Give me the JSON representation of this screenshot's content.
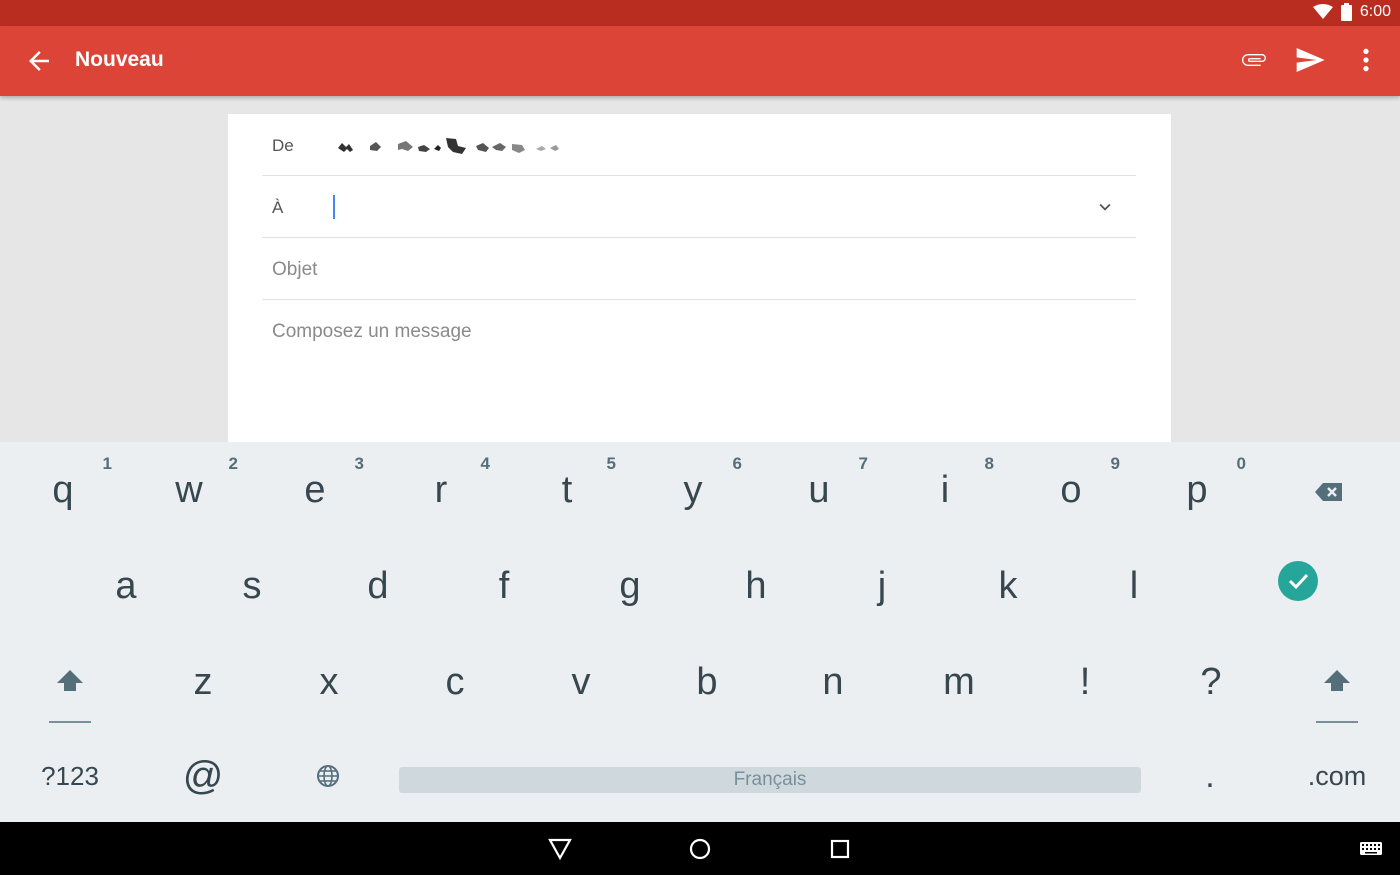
{
  "status_bar": {
    "time": "6:00",
    "icons": [
      "wifi-icon",
      "battery-icon"
    ]
  },
  "app_bar": {
    "title": "Nouveau",
    "icons": [
      "back-arrow-icon",
      "attach-icon",
      "send-icon",
      "more-vert-icon"
    ]
  },
  "compose": {
    "from_label": "De",
    "to_label": "À",
    "subject_placeholder": "Objet",
    "body_placeholder": "Composez un message"
  },
  "keyboard": {
    "row1": [
      {
        "key": "q",
        "hint": "1"
      },
      {
        "key": "w",
        "hint": "2"
      },
      {
        "key": "e",
        "hint": "3"
      },
      {
        "key": "r",
        "hint": "4"
      },
      {
        "key": "t",
        "hint": "5"
      },
      {
        "key": "y",
        "hint": "6"
      },
      {
        "key": "u",
        "hint": "7"
      },
      {
        "key": "i",
        "hint": "8"
      },
      {
        "key": "o",
        "hint": "9"
      },
      {
        "key": "p",
        "hint": "0"
      }
    ],
    "row2": [
      "a",
      "s",
      "d",
      "f",
      "g",
      "h",
      "j",
      "k",
      "l"
    ],
    "row3": [
      "z",
      "x",
      "c",
      "v",
      "b",
      "n",
      "m",
      "!",
      "?"
    ],
    "symbols_key": "?123",
    "at_key": "@",
    "space_label": "Français",
    "period_key": ".",
    "dotcom_key": ".com",
    "accent_color": "#26a69a"
  },
  "colors": {
    "app_bar": "#db4437",
    "status_bar": "#b92d21",
    "cursor": "#4285f4"
  }
}
